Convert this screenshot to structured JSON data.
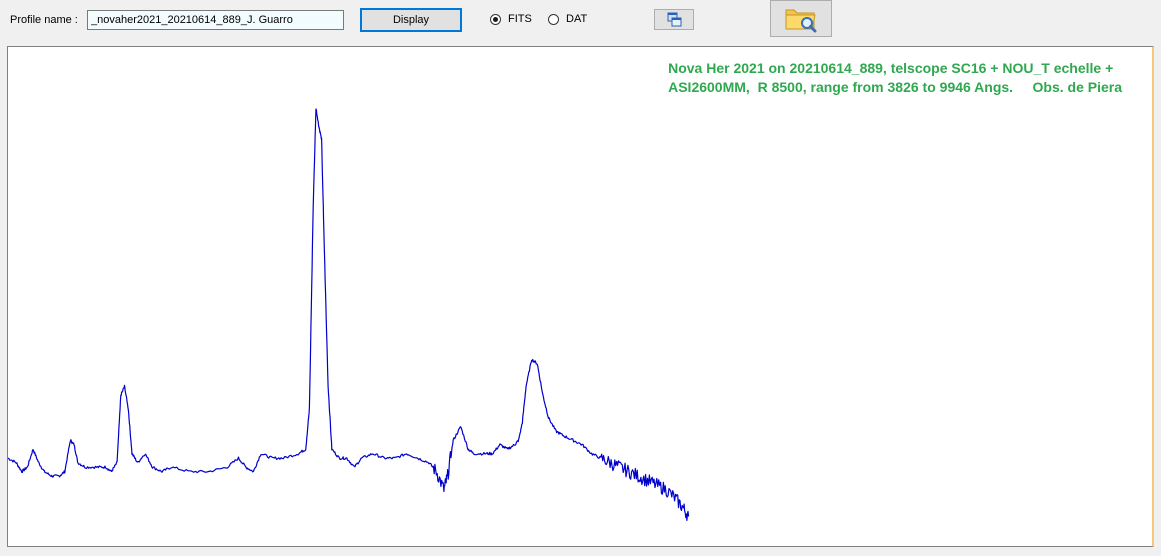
{
  "toolbar": {
    "profile_label": "Profile name :",
    "profile_value": "_novaher2021_20210614_889_J. Guarro",
    "display_label": "Display",
    "radio_fits": "FITS",
    "radio_dat": "DAT",
    "selected_format": "FITS",
    "copy_icon": "copy-windows-icon",
    "open_icon": "folder-search-icon"
  },
  "plot": {
    "annotation_line1": "Nova Her 2021 on 20210614_889, telscope SC16 + NOU_T echelle +",
    "annotation_line2": "ASI2600MM,  R 8500, range from 3826 to 9946 Angs.     Obs. de Piera",
    "line_color": "#0000cc",
    "annotation_color": "#2fa84f"
  },
  "chart_data": {
    "type": "line",
    "title": "",
    "xlabel": "",
    "ylabel": "",
    "x_range": [
      3826,
      9946
    ],
    "series": [
      {
        "points": [
          [
            3826,
            0.14
          ],
          [
            3870,
            0.13
          ],
          [
            3900,
            0.11
          ],
          [
            3930,
            0.12
          ],
          [
            3960,
            0.16
          ],
          [
            3990,
            0.13
          ],
          [
            4020,
            0.11
          ],
          [
            4060,
            0.1
          ],
          [
            4100,
            0.1
          ],
          [
            4130,
            0.11
          ],
          [
            4160,
            0.18
          ],
          [
            4180,
            0.17
          ],
          [
            4200,
            0.13
          ],
          [
            4240,
            0.12
          ],
          [
            4300,
            0.12
          ],
          [
            4350,
            0.12
          ],
          [
            4380,
            0.11
          ],
          [
            4410,
            0.13
          ],
          [
            4430,
            0.28
          ],
          [
            4450,
            0.3
          ],
          [
            4470,
            0.25
          ],
          [
            4490,
            0.15
          ],
          [
            4520,
            0.13
          ],
          [
            4560,
            0.15
          ],
          [
            4600,
            0.12
          ],
          [
            4650,
            0.11
          ],
          [
            4700,
            0.12
          ],
          [
            4800,
            0.11
          ],
          [
            4900,
            0.11
          ],
          [
            5000,
            0.12
          ],
          [
            5060,
            0.14
          ],
          [
            5100,
            0.12
          ],
          [
            5140,
            0.11
          ],
          [
            5180,
            0.15
          ],
          [
            5240,
            0.14
          ],
          [
            5300,
            0.14
          ],
          [
            5380,
            0.15
          ],
          [
            5420,
            0.16
          ],
          [
            5440,
            0.25
          ],
          [
            5460,
            0.7
          ],
          [
            5475,
            0.92
          ],
          [
            5490,
            0.88
          ],
          [
            5505,
            0.85
          ],
          [
            5520,
            0.6
          ],
          [
            5540,
            0.3
          ],
          [
            5560,
            0.16
          ],
          [
            5600,
            0.14
          ],
          [
            5640,
            0.14
          ],
          [
            5680,
            0.12
          ],
          [
            5720,
            0.14
          ],
          [
            5780,
            0.15
          ],
          [
            5840,
            0.14
          ],
          [
            5900,
            0.14
          ],
          [
            5960,
            0.15
          ],
          [
            6020,
            0.14
          ],
          [
            6080,
            0.13
          ],
          [
            6120,
            0.11
          ],
          [
            6160,
            0.07
          ],
          [
            6180,
            0.1
          ],
          [
            6210,
            0.18
          ],
          [
            6250,
            0.21
          ],
          [
            6290,
            0.16
          ],
          [
            6320,
            0.15
          ],
          [
            6380,
            0.15
          ],
          [
            6420,
            0.15
          ],
          [
            6460,
            0.17
          ],
          [
            6500,
            0.16
          ],
          [
            6540,
            0.17
          ],
          [
            6560,
            0.18
          ],
          [
            6580,
            0.22
          ],
          [
            6600,
            0.3
          ],
          [
            6630,
            0.36
          ],
          [
            6660,
            0.35
          ],
          [
            6690,
            0.28
          ],
          [
            6720,
            0.23
          ],
          [
            6760,
            0.2
          ],
          [
            6800,
            0.19
          ],
          [
            6850,
            0.18
          ],
          [
            6900,
            0.17
          ],
          [
            6950,
            0.15
          ],
          [
            7000,
            0.14
          ],
          [
            7050,
            0.13
          ],
          [
            7100,
            0.12
          ],
          [
            7150,
            0.11
          ],
          [
            7200,
            0.1
          ],
          [
            7250,
            0.09
          ],
          [
            7300,
            0.08
          ],
          [
            7350,
            0.07
          ],
          [
            7400,
            0.05
          ],
          [
            7440,
            0.03
          ],
          [
            7470,
            0.01
          ]
        ]
      }
    ]
  }
}
